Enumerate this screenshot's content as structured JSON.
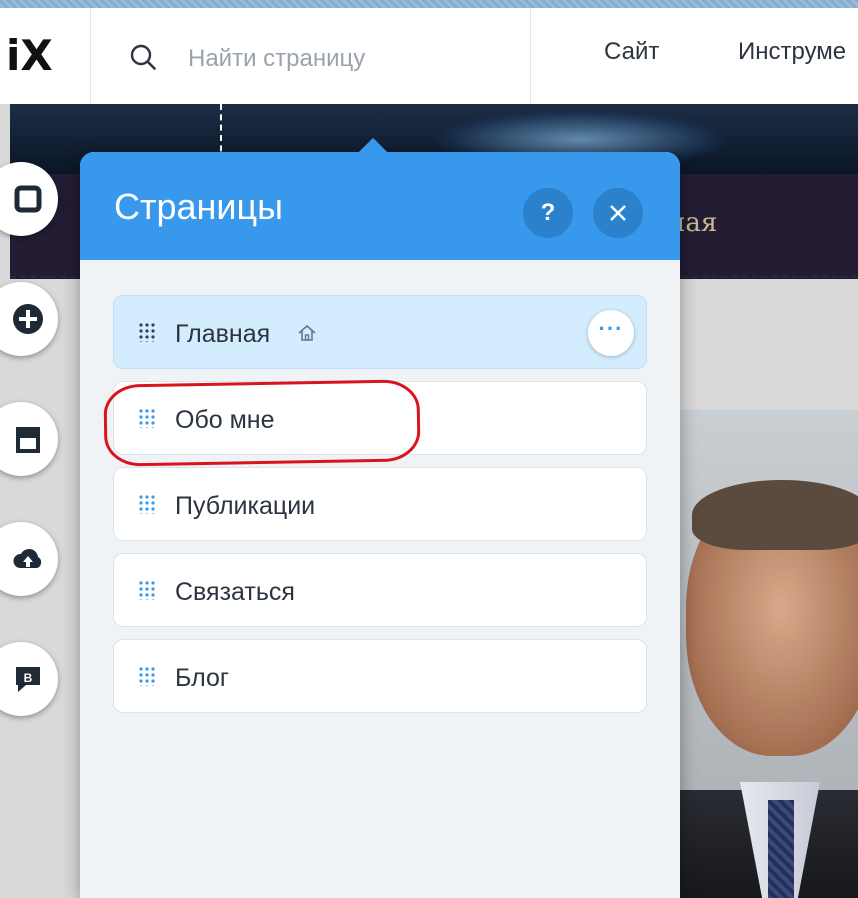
{
  "topbar": {
    "logo_text": "iX",
    "search": {
      "placeholder": "Найти страницу"
    },
    "menu": [
      {
        "label": "Сайт"
      },
      {
        "label": "Инструме"
      }
    ]
  },
  "canvas": {
    "nav_fragment": "ная"
  },
  "rail": [
    {
      "icon": "pages-icon"
    },
    {
      "icon": "add-icon"
    },
    {
      "icon": "store-icon"
    },
    {
      "icon": "upload-icon"
    },
    {
      "icon": "blog-icon"
    }
  ],
  "pages_panel": {
    "title": "Страницы",
    "help_label": "?",
    "close_label": "✕",
    "more_label": "···",
    "pages": [
      {
        "label": "Главная",
        "is_home": true,
        "selected": true
      },
      {
        "label": "Обо мне",
        "is_home": false,
        "selected": false
      },
      {
        "label": "Публикации",
        "is_home": false,
        "selected": false
      },
      {
        "label": "Связаться",
        "is_home": false,
        "selected": false
      },
      {
        "label": "Блог",
        "is_home": false,
        "selected": false
      }
    ]
  },
  "colors": {
    "accent": "#3899ec",
    "selected_row": "#d3edff",
    "annotation": "#d8141e"
  }
}
